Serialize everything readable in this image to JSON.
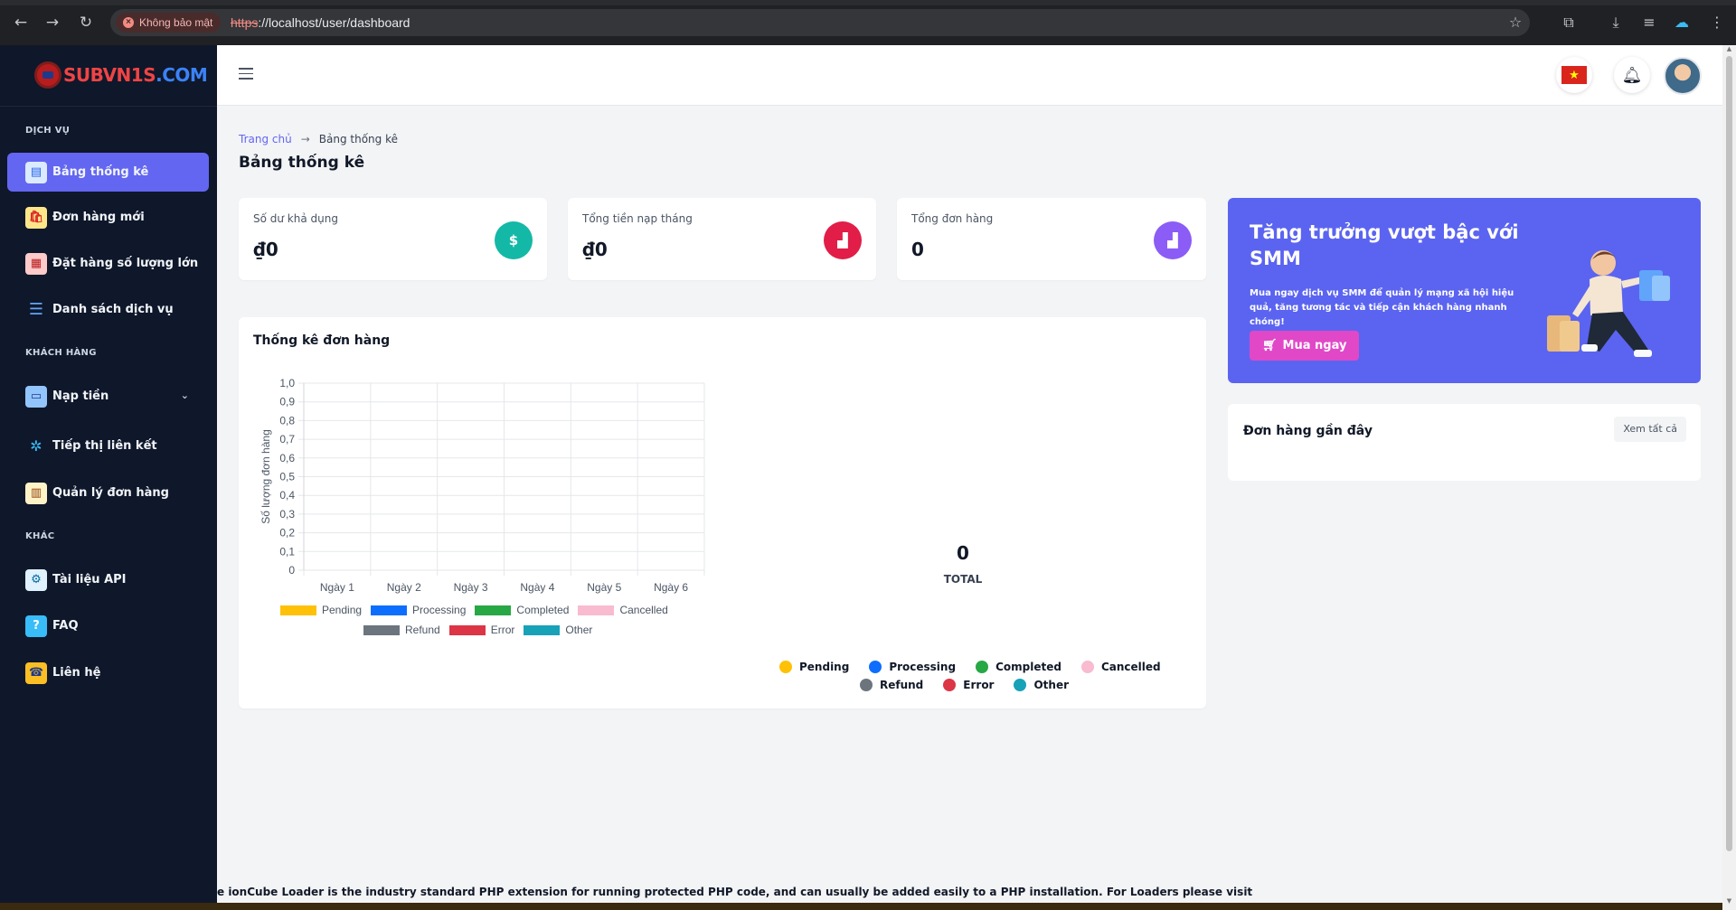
{
  "browser": {
    "security_label": "Không bảo mật",
    "url_scheme": "https",
    "url_rest": "://localhost/user/dashboard"
  },
  "brand": {
    "logo_primary": "SUBVN1S",
    "logo_domain": ".COM"
  },
  "sidebar": {
    "sections": [
      {
        "title": "DỊCH VỤ"
      },
      {
        "title": "KHÁCH HÀNG"
      },
      {
        "title": "KHÁC"
      }
    ],
    "items": [
      {
        "label": "Bảng thống kê",
        "icon": "dashboard-icon"
      },
      {
        "label": "Đơn hàng mới",
        "icon": "shopping-bag-icon"
      },
      {
        "label": "Đặt hàng số lượng lớn",
        "icon": "bulk-order-icon"
      },
      {
        "label": "Danh sách dịch vụ",
        "icon": "list-icon"
      },
      {
        "label": "Nạp tiền",
        "icon": "wallet-icon"
      },
      {
        "label": "Tiếp thị liên kết",
        "icon": "affiliate-icon"
      },
      {
        "label": "Quản lý đơn hàng",
        "icon": "order-management-icon"
      },
      {
        "label": "Tài liệu API",
        "icon": "api-docs-icon"
      },
      {
        "label": "FAQ",
        "icon": "faq-icon"
      },
      {
        "label": "Liên hệ",
        "icon": "contact-icon"
      }
    ]
  },
  "breadcrumb": {
    "home": "Trang chủ",
    "current": "Bảng thống kê"
  },
  "page_title": "Bảng thống kê",
  "stats": [
    {
      "label": "Số dư khả dụng",
      "value": "₫0",
      "color": "#14b8a6",
      "glyph": "$"
    },
    {
      "label": "Tổng tiền nạp tháng",
      "value": "₫0",
      "color": "#e11d48",
      "glyph": "▟"
    },
    {
      "label": "Tổng đơn hàng",
      "value": "0",
      "color": "#8b5cf6",
      "glyph": "▟"
    }
  ],
  "chart_section": {
    "title": "Thống kê đơn hàng"
  },
  "chart_data": [
    {
      "type": "bar",
      "categories": [
        "Ngày 1",
        "Ngày 2",
        "Ngày 3",
        "Ngày 4",
        "Ngày 5",
        "Ngày 6"
      ],
      "ylabel": "Số lượng đơn hàng",
      "ylim": [
        0,
        1.0
      ],
      "yticks": [
        "0",
        "0,1",
        "0,2",
        "0,3",
        "0,4",
        "0,5",
        "0,6",
        "0,7",
        "0,8",
        "0,9",
        "1,0"
      ],
      "grid": true,
      "legend_position": "bottom",
      "series": [
        {
          "name": "Pending",
          "color": "#ffc107",
          "values": [
            0,
            0,
            0,
            0,
            0,
            0
          ]
        },
        {
          "name": "Processing",
          "color": "#0d6efd",
          "values": [
            0,
            0,
            0,
            0,
            0,
            0
          ]
        },
        {
          "name": "Completed",
          "color": "#28a745",
          "values": [
            0,
            0,
            0,
            0,
            0,
            0
          ]
        },
        {
          "name": "Cancelled",
          "color": "#f8bbd0",
          "values": [
            0,
            0,
            0,
            0,
            0,
            0
          ]
        },
        {
          "name": "Refund",
          "color": "#6c757d",
          "values": [
            0,
            0,
            0,
            0,
            0,
            0
          ]
        },
        {
          "name": "Error",
          "color": "#dc3545",
          "values": [
            0,
            0,
            0,
            0,
            0,
            0
          ]
        },
        {
          "name": "Other",
          "color": "#17a2b8",
          "values": [
            0,
            0,
            0,
            0,
            0,
            0
          ]
        }
      ]
    },
    {
      "type": "pie",
      "center_value": "0",
      "center_label": "TOTAL",
      "legend_position": "bottom",
      "slices": [
        {
          "name": "Pending",
          "color": "#ffc107",
          "value": 0
        },
        {
          "name": "Processing",
          "color": "#0d6efd",
          "value": 0
        },
        {
          "name": "Completed",
          "color": "#28a745",
          "value": 0
        },
        {
          "name": "Cancelled",
          "color": "#f8bbd0",
          "value": 0
        },
        {
          "name": "Refund",
          "color": "#6c757d",
          "value": 0
        },
        {
          "name": "Error",
          "color": "#dc3545",
          "value": 0
        },
        {
          "name": "Other",
          "color": "#17a2b8",
          "value": 0
        }
      ]
    }
  ],
  "promo": {
    "title": "Tăng trưởng vượt bậc với SMM",
    "description": "Mua ngay dịch vụ SMM để quản lý mạng xã hội hiệu quả, tăng tương tác và tiếp cận khách hàng nhanh chóng!",
    "button_label": "Mua ngay"
  },
  "recent_orders": {
    "title": "Đơn hàng gần đây",
    "view_all_label": "Xem tất cả"
  },
  "footer_message": "e ionCube Loader is the industry standard PHP extension for running protected PHP code, and can usually be added easily to a PHP installation. For Loaders please visit"
}
